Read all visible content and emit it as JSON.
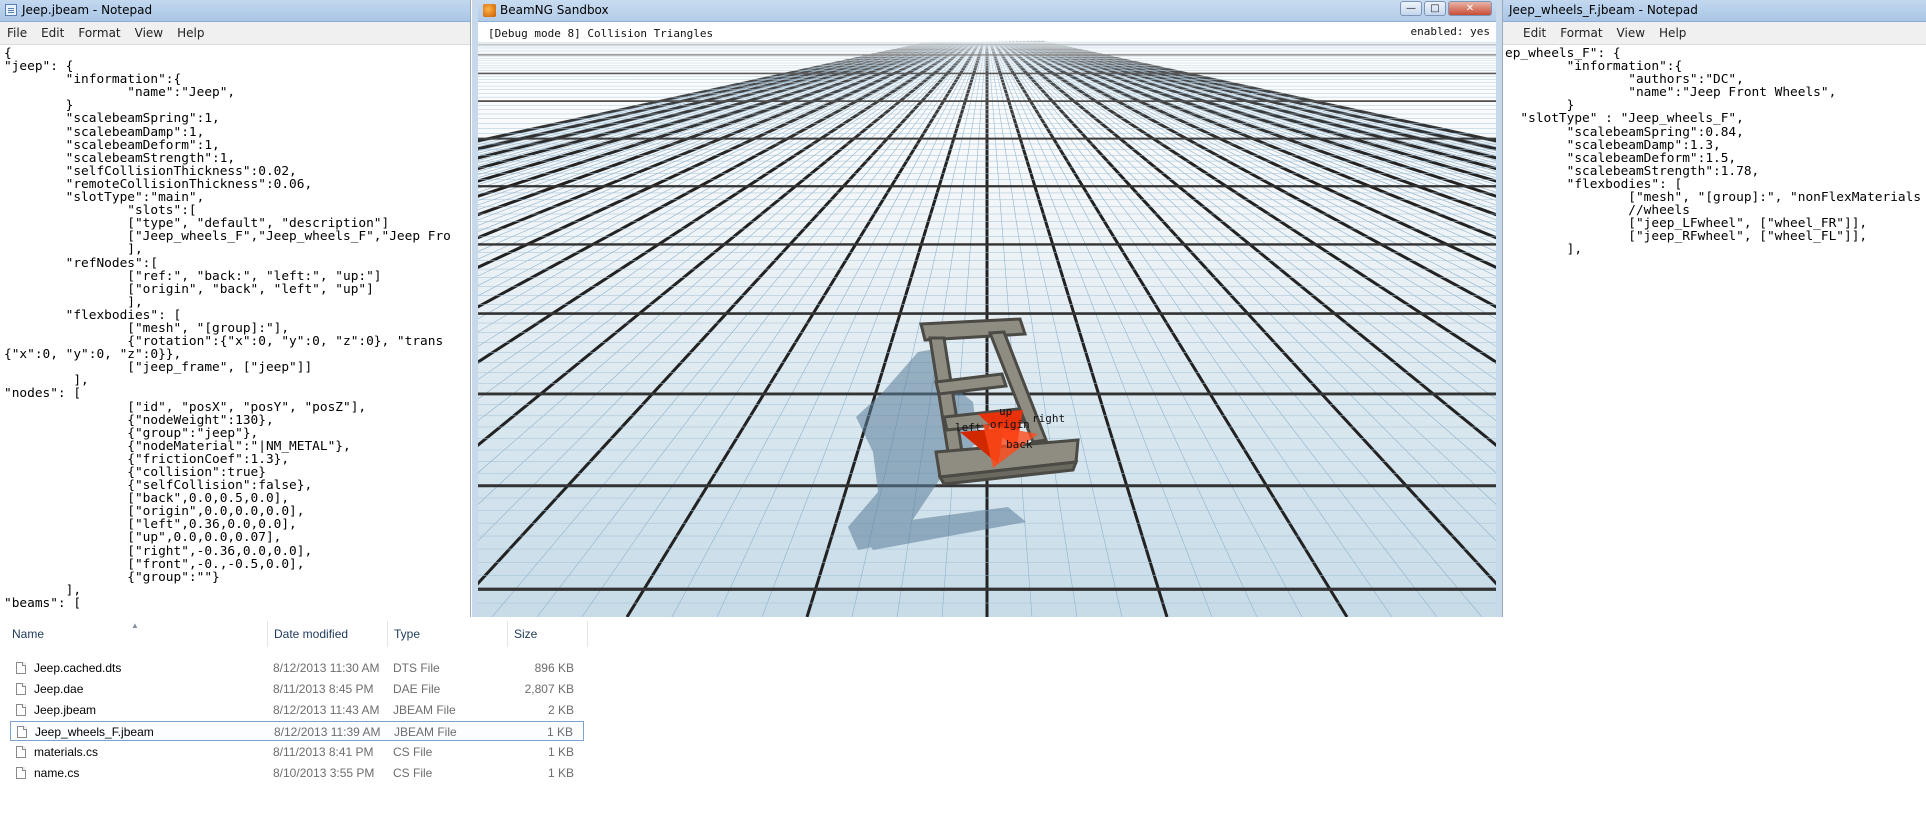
{
  "left_notepad": {
    "title": "Jeep.jbeam - Notepad",
    "menu": [
      "File",
      "Edit",
      "Format",
      "View",
      "Help"
    ],
    "content": "{\n\"jeep\": {\n        \"information\":{\n                \"name\":\"Jeep\",\n        }\n        \"scalebeamSpring\":1,\n        \"scalebeamDamp\":1,\n        \"scalebeamDeform\":1,\n        \"scalebeamStrength\":1,\n        \"selfCollisionThickness\":0.02,\n        \"remoteCollisionThickness\":0.06,\n        \"slotType\":\"main\",\n                \"slots\":[\n                [\"type\", \"default\", \"description\"]\n                [\"Jeep_wheels_F\",\"Jeep_wheels_F\",\"Jeep Fro\n                ],\n        \"refNodes\":[\n                [\"ref:\", \"back:\", \"left:\", \"up:\"]\n                [\"origin\", \"back\", \"left\", \"up\"]\n                ],\n        \"flexbodies\": [\n                [\"mesh\", \"[group]:\"],\n                {\"rotation\":{\"x\":0, \"y\":0, \"z\":0}, \"trans\n{\"x\":0, \"y\":0, \"z\":0}},\n                [\"jeep_frame\", [\"jeep\"]]\n         ],\n\"nodes\": [\n                [\"id\", \"posX\", \"posY\", \"posZ\"],\n                {\"nodeWeight\":130},\n                {\"group\":\"jeep\"},\n                {\"nodeMaterial\":\"|NM_METAL\"},\n                {\"frictionCoef\":1.3},\n                {\"collision\":true}\n                {\"selfCollision\":false},\n                [\"back\",0.0,0.5,0.0],\n                [\"origin\",0.0,0.0,0.0],\n                [\"left\",0.36,0.0,0.0],\n                [\"up\",0.0,0.0,0.07],\n                [\"right\",-0.36,0.0,0.0],\n                [\"front\",-0.,-0.5,0.0],\n                {\"group\":\"\"}\n        ],\n\"beams\": ["
  },
  "right_notepad": {
    "title": "Jeep_wheels_F.jbeam - Notepad",
    "menu": [
      "Edit",
      "Format",
      "View",
      "Help"
    ],
    "content": "ep_wheels_F\": {\n        \"information\":{\n                \"authors\":\"DC\",\n                \"name\":\"Jeep Front Wheels\",\n        }\n  \"slotType\" : \"Jeep_wheels_F\",\n        \"scalebeamSpring\":0.84,\n        \"scalebeamDamp\":1.3,\n        \"scalebeamDeform\":1.5,\n        \"scalebeamStrength\":1.78,\n        \"flexbodies\": [\n                [\"mesh\", \"[group]:\", \"nonFlexMaterials\n                //wheels\n                [\"jeep_LFwheel\", [\"wheel_FR\"]],\n                [\"jeep_RFwheel\", [\"wheel_FL\"]],\n        ],"
  },
  "beamng": {
    "title": "BeamNG Sandbox",
    "debug_text": "[Debug mode 8] Collision Triangles",
    "enabled_text": "enabled: yes",
    "buttons": {
      "minimize": "—",
      "maximize": "□",
      "close": "✕"
    },
    "node_labels": {
      "up": "up",
      "left": "left",
      "origin": "origin",
      "right": "right",
      "back": "back"
    }
  },
  "explorer": {
    "columns": {
      "name": "Name",
      "date": "Date modified",
      "type": "Type",
      "size": "Size"
    },
    "files": [
      {
        "name": "Jeep.cached.dts",
        "date": "8/12/2013 11:30 AM",
        "type": "DTS File",
        "size": "896 KB",
        "selected": false
      },
      {
        "name": "Jeep.dae",
        "date": "8/11/2013 8:45 PM",
        "type": "DAE File",
        "size": "2,807 KB",
        "selected": false
      },
      {
        "name": "Jeep.jbeam",
        "date": "8/12/2013 11:43 AM",
        "type": "JBEAM File",
        "size": "2 KB",
        "selected": false
      },
      {
        "name": "Jeep_wheels_F.jbeam",
        "date": "8/12/2013 11:39 AM",
        "type": "JBEAM File",
        "size": "1 KB",
        "selected": true
      },
      {
        "name": "materials.cs",
        "date": "8/11/2013 8:41 PM",
        "type": "CS File",
        "size": "1 KB",
        "selected": false
      },
      {
        "name": "name.cs",
        "date": "8/10/2013 3:55 PM",
        "type": "CS File",
        "size": "1 KB",
        "selected": false
      }
    ]
  }
}
